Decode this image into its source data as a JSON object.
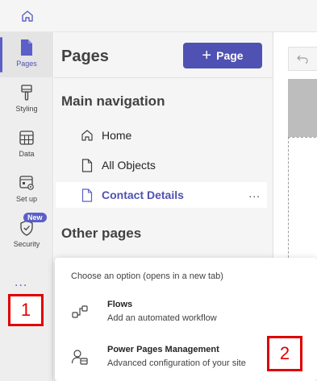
{
  "left_rail": {
    "items": [
      {
        "label": "Pages",
        "icon": "page-icon"
      },
      {
        "label": "Styling",
        "icon": "paintbrush-icon"
      },
      {
        "label": "Data",
        "icon": "table-icon"
      },
      {
        "label": "Set up",
        "icon": "setup-icon"
      },
      {
        "label": "Security",
        "icon": "shield-icon"
      }
    ],
    "new_badge": "New",
    "more": "..."
  },
  "pages_panel": {
    "title": "Pages",
    "add_button_label": "Page",
    "main_nav_heading": "Main navigation",
    "main_nav_items": [
      "Home",
      "All Objects",
      "Contact Details"
    ],
    "row_more": "...",
    "other_pages_heading": "Other pages"
  },
  "popup": {
    "hint": "Choose an option (opens in a new tab)",
    "options": [
      {
        "title": "Flows",
        "desc": "Add an automated workflow",
        "icon": "flow-icon"
      },
      {
        "title": "Power Pages Management",
        "desc": "Advanced configuration of your site",
        "icon": "management-icon"
      }
    ]
  },
  "callouts": [
    "1",
    "2"
  ],
  "colors": {
    "accent": "#5b5fc7",
    "callout": "#e00000"
  }
}
